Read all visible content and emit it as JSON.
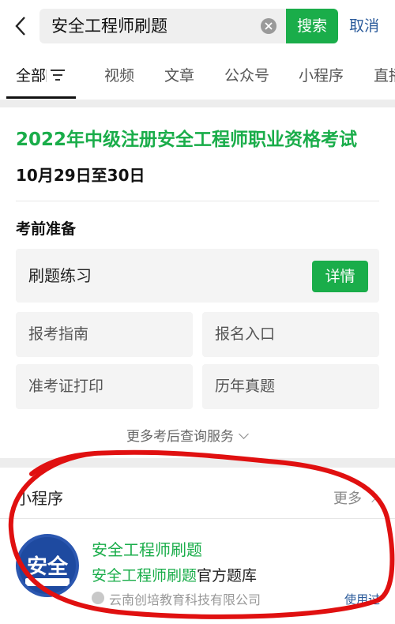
{
  "search": {
    "value": "安全工程师刷题",
    "button": "搜索",
    "cancel": "取消"
  },
  "tabs": [
    {
      "label": "全部",
      "active": true
    },
    {
      "label": "视频"
    },
    {
      "label": "文章"
    },
    {
      "label": "公众号"
    },
    {
      "label": "小程序"
    },
    {
      "label": "直播"
    }
  ],
  "exam": {
    "title": "2022年中级注册安全工程师职业资格考试",
    "date": "10月29日至30日",
    "section_label": "考前准备",
    "primary_tile": {
      "label": "刷题练习",
      "button": "详情"
    },
    "tiles": [
      "报考指南",
      "报名入口",
      "准考证打印",
      "历年真题"
    ],
    "more": "更多考后查询服务"
  },
  "mini_program": {
    "header": "小程序",
    "more": "更多",
    "app": {
      "name": "安全工程师刷题",
      "desc_highlight": "安全工程师刷题",
      "desc_rest": "官方题库",
      "company": "云南创培教育科技有限公司",
      "action": "使用过",
      "logo_text": "安全"
    }
  },
  "colors": {
    "accent": "#1aad4a",
    "link": "#2b5b9b",
    "annotation": "#e01010"
  }
}
